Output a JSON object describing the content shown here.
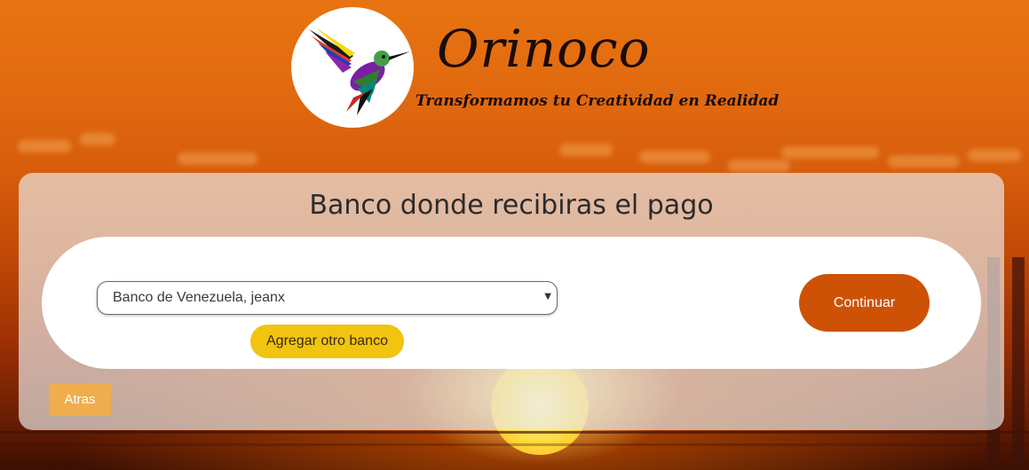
{
  "brand": {
    "name": "Orinoco",
    "tagline": "Transformamos tu Creatividad en Realidad"
  },
  "page": {
    "title": "Banco donde recibiras el pago"
  },
  "bank_select": {
    "selected_value": "Banco de Venezuela, jeanx"
  },
  "buttons": {
    "add_bank": "Agregar otro banco",
    "continue": "Continuar",
    "back": "Atras"
  },
  "colors": {
    "continue_button": "#cd5206",
    "add_bank_button": "#f1c40f",
    "back_button": "#f0ad4e"
  },
  "icons": {
    "logo": "hummingbird-icon",
    "select_arrow": "chevron-down-icon"
  }
}
